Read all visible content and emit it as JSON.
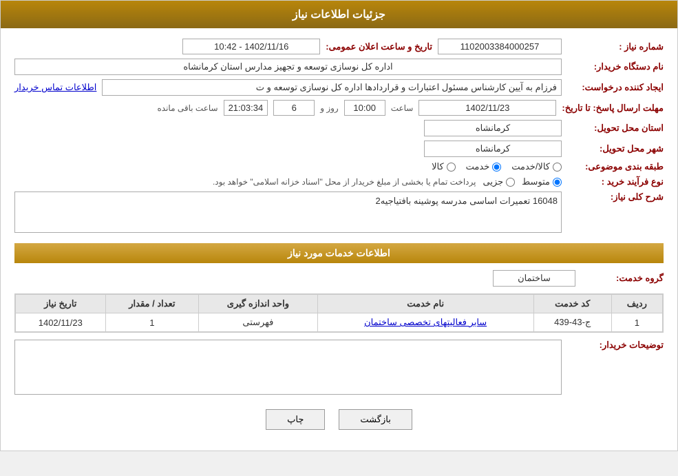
{
  "header": {
    "title": "جزئیات اطلاعات نیاز"
  },
  "fields": {
    "need_number_label": "شماره نیاز :",
    "need_number_value": "1102003384000257",
    "announcement_label": "تاریخ و ساعت اعلان عمومی:",
    "announcement_value": "1402/11/16 - 10:42",
    "buyer_org_label": "نام دستگاه خریدار:",
    "buyer_org_value": "اداره کل نوسازی  توسعه و تجهیز مدارس استان کرمانشاه",
    "creator_label": "ایجاد کننده درخواست:",
    "creator_value": "فرزام به آیین کارشناس مسئول اعتبارات و قراردادها اداره کل نوسازی  توسعه و ت",
    "creator_link": "اطلاعات تماس خریدار",
    "deadline_label": "مهلت ارسال پاسخ: تا تاریخ:",
    "deadline_date": "1402/11/23",
    "deadline_time_label": "ساعت",
    "deadline_time": "10:00",
    "deadline_day_label": "روز و",
    "deadline_days": "6",
    "deadline_remaining_label": "ساعت باقی مانده",
    "deadline_remaining": "21:03:34",
    "province_label": "استان محل تحویل:",
    "province_value": "کرمانشاه",
    "city_label": "شهر محل تحویل:",
    "city_value": "کرمانشاه",
    "category_label": "طبقه بندی موضوعی:",
    "category_options": [
      {
        "label": "کالا",
        "value": "kala"
      },
      {
        "label": "خدمت",
        "value": "khedmat"
      },
      {
        "label": "کالا/خدمت",
        "value": "kala_khedmat"
      }
    ],
    "category_selected": "khedmat",
    "purchase_type_label": "نوع فرآیند خرید :",
    "purchase_type_options": [
      {
        "label": "جزیی",
        "value": "jozi"
      },
      {
        "label": "متوسط",
        "value": "motavasset"
      }
    ],
    "purchase_type_selected": "motavasset",
    "purchase_type_note": "پرداخت تمام یا بخشی از مبلغ خریدار از محل \"اسناد خزانه اسلامی\" خواهد بود.",
    "need_desc_label": "شرح کلی نیاز:",
    "need_desc_value": "16048 تعمیرات اساسی مدرسه پوشینه بافتیاجیه2",
    "services_section_title": "اطلاعات خدمات مورد نیاز",
    "service_group_label": "گروه خدمت:",
    "service_group_value": "ساختمان",
    "table": {
      "headers": [
        "ردیف",
        "کد خدمت",
        "نام خدمت",
        "واحد اندازه گیری",
        "تعداد / مقدار",
        "تاریخ نیاز"
      ],
      "rows": [
        {
          "row_num": "1",
          "service_code": "ج-43-439",
          "service_name": "سایر فعالیتهای تخصصی ساختمان",
          "unit": "فهرستی",
          "quantity": "1",
          "date": "1402/11/23"
        }
      ]
    },
    "buyer_desc_label": "توضیحات خریدار:",
    "buyer_desc_value": ""
  },
  "buttons": {
    "print": "چاپ",
    "back": "بازگشت"
  }
}
